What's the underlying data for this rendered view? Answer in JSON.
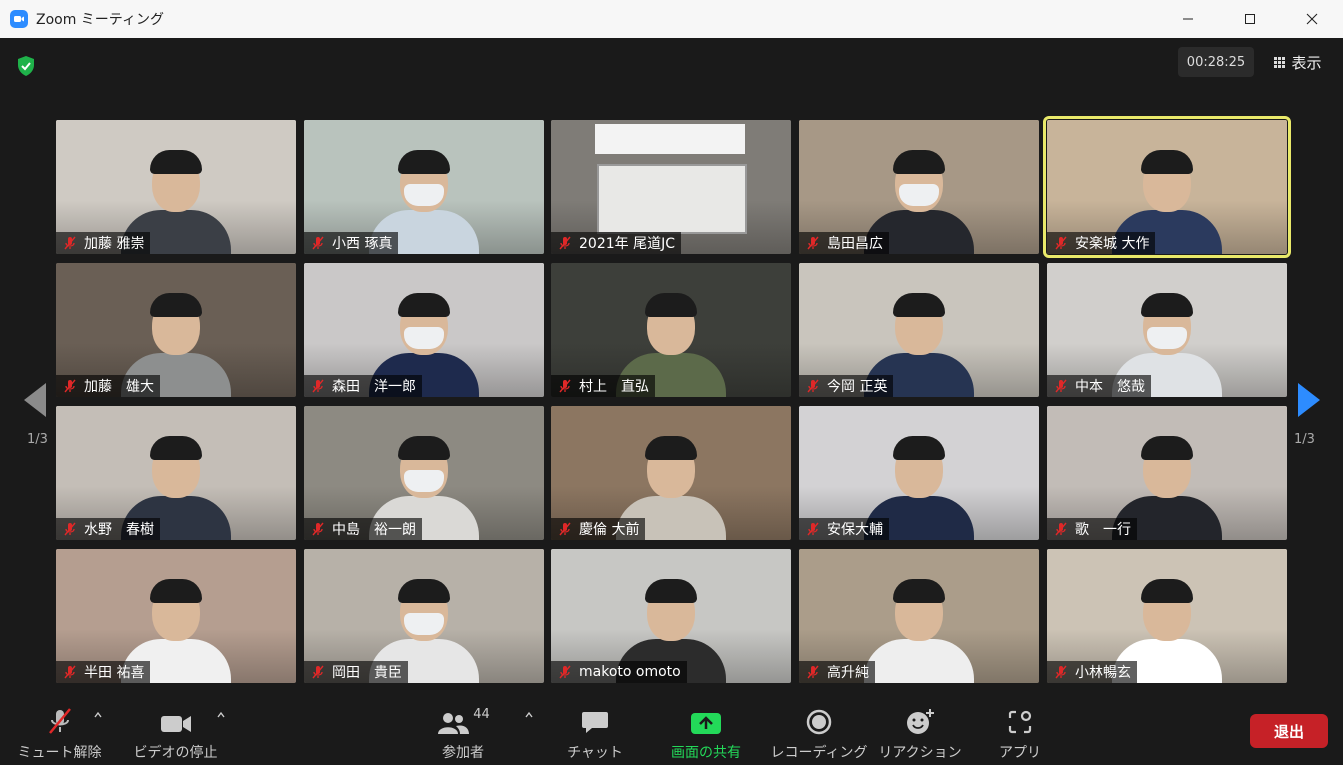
{
  "window": {
    "title": "Zoom ミーティング"
  },
  "header": {
    "timer": "00:28:25",
    "view_label": "表示"
  },
  "pagination": {
    "left": "1/3",
    "right": "1/3"
  },
  "participants": [
    {
      "name": "加藤 雅崇",
      "bg": "#cfcac3",
      "body": "#3b3f46",
      "mask": false,
      "active": false
    },
    {
      "name": "小西 琢真",
      "bg": "#b9c3bd",
      "body": "#c9d5df",
      "mask": true,
      "active": false
    },
    {
      "name": "2021年 尾道JC",
      "bg": "#7f7c77",
      "body": "",
      "mask": false,
      "active": false
    },
    {
      "name": "島田昌広",
      "bg": "#a79886",
      "body": "#25272d",
      "mask": true,
      "active": false
    },
    {
      "name": "安楽城 大作",
      "bg": "#c8b49a",
      "body": "#2b3a5e",
      "mask": false,
      "active": true
    },
    {
      "name": "加藤　雄大",
      "bg": "#6a5f55",
      "body": "#8d8f8f",
      "mask": false,
      "active": false
    },
    {
      "name": "森田　洋一郎",
      "bg": "#cac8c8",
      "body": "#1e2a4d",
      "mask": true,
      "active": false
    },
    {
      "name": "村上　直弘",
      "bg": "#3d3f3a",
      "body": "#5c6a4a",
      "mask": false,
      "active": false
    },
    {
      "name": "今岡 正英",
      "bg": "#c9c5bd",
      "body": "#263452",
      "mask": false,
      "active": false
    },
    {
      "name": "中本　悠哉",
      "bg": "#d1cfcc",
      "body": "#dfe2e5",
      "mask": true,
      "active": false
    },
    {
      "name": "水野　春樹",
      "bg": "#c4beb7",
      "body": "#2d3442",
      "mask": false,
      "active": false
    },
    {
      "name": "中島　裕一朗",
      "bg": "#8d8a82",
      "body": "#dad9d6",
      "mask": true,
      "active": false
    },
    {
      "name": "慶倫 大前",
      "bg": "#8c7661",
      "body": "#c8c2b8",
      "mask": false,
      "active": false
    },
    {
      "name": "安保大輔",
      "bg": "#d3d2d4",
      "body": "#1f2a46",
      "mask": false,
      "active": false
    },
    {
      "name": "歌　一行",
      "bg": "#c2bcb7",
      "body": "#23252b",
      "mask": false,
      "active": false
    },
    {
      "name": "半田 祐喜",
      "bg": "#b59e90",
      "body": "#f0f0f0",
      "mask": false,
      "active": false
    },
    {
      "name": "岡田　貴臣",
      "bg": "#b7b1a8",
      "body": "#e6e6e6",
      "mask": true,
      "active": false
    },
    {
      "name": "makoto omoto",
      "bg": "#c7c7c4",
      "body": "#2c2c2c",
      "mask": false,
      "active": false
    },
    {
      "name": "高升純",
      "bg": "#ab9d8a",
      "body": "#eeeeee",
      "mask": false,
      "active": false
    },
    {
      "name": "小林暢玄",
      "bg": "#ccc3b5",
      "body": "#ffffff",
      "mask": false,
      "active": false
    }
  ],
  "toolbar": {
    "unmute_label": "ミュート解除",
    "video_label": "ビデオの停止",
    "participants_label": "参加者",
    "participants_count": "44",
    "chat_label": "チャット",
    "share_label": "画面の共有",
    "record_label": "レコーディング",
    "reaction_label": "リアクション",
    "apps_label": "アプリ",
    "end_label": "退出"
  },
  "colors": {
    "accent": "#2d8cff",
    "share": "#23d959",
    "end": "#c62127",
    "active_speaker": "#e9e96a"
  }
}
